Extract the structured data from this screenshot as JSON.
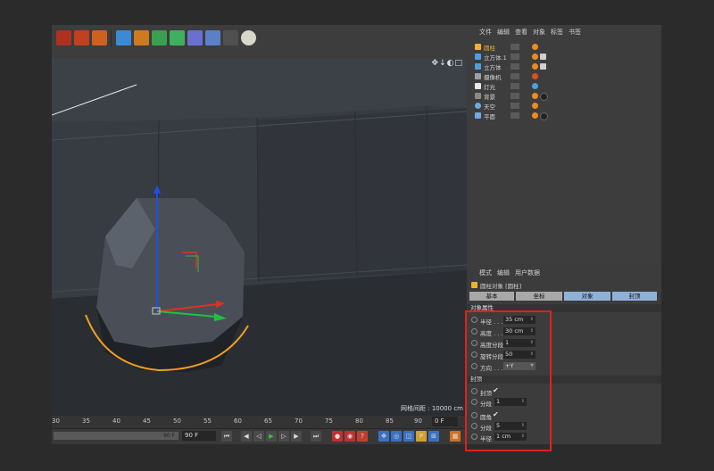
{
  "viewport": {
    "grid_spacing": "网格间距 : 10000 cm",
    "nav_icons": "✥↓◐□"
  },
  "timeline": {
    "ticks": [
      "30",
      "35",
      "40",
      "45",
      "50",
      "55",
      "60",
      "65",
      "70",
      "75",
      "80",
      "85",
      "90"
    ],
    "current_frame": "0 F",
    "range_end": "90 F",
    "end_frame": "90 F"
  },
  "object_manager": {
    "menu": [
      "文件",
      "编辑",
      "查看",
      "对象",
      "标签",
      "书签"
    ],
    "objects": [
      {
        "name": "圆柱",
        "color": "#f0b030",
        "tags": [
          "#f08a20"
        ]
      },
      {
        "name": "立方体.1",
        "color": "#4aa0e0",
        "tags": [
          "#f08a20",
          "#d0d0d0"
        ]
      },
      {
        "name": "立方体",
        "color": "#4aa0e0",
        "tags": [
          "#f08a20",
          "#d0d0d0"
        ]
      },
      {
        "name": "摄像机",
        "color": "#9aa0a8",
        "tags": [
          "#e05020"
        ]
      },
      {
        "name": "灯光",
        "color": "#e8e8e8",
        "tags": [
          "#4aa0e0"
        ]
      },
      {
        "name": "背景",
        "color": "#8a8a8a",
        "tags": [
          "#f08a20",
          "#222222"
        ]
      },
      {
        "name": "天空",
        "color": "#70a8e0",
        "tags": [
          "#f08a20"
        ]
      },
      {
        "name": "平面",
        "color": "#70a8e0",
        "tags": [
          "#f08a20",
          "#222222"
        ]
      }
    ]
  },
  "attribute_manager": {
    "menu": [
      "模式",
      "编辑",
      "用户数据"
    ],
    "object_title": "圆柱对象 [圆柱]",
    "tabs": [
      "基本",
      "坐标",
      "对象",
      "封顶"
    ],
    "section_object": "对象属性",
    "props": [
      {
        "label": "半径 . . .",
        "value": "35 cm"
      },
      {
        "label": "高度 . . .",
        "value": "30 cm"
      },
      {
        "label": "高度分段",
        "value": "1"
      },
      {
        "label": "旋转分段",
        "value": "50"
      },
      {
        "label": "方向 . . .",
        "value": "+Y"
      }
    ],
    "section_caps": "封顶",
    "caps": {
      "cap_label": "封顶",
      "cap_check": "✔",
      "cap_seg_label": "分段",
      "cap_seg_value": "1",
      "fillet_label": "圆角",
      "fillet_check": "✔",
      "fillet_seg_label": "分段",
      "fillet_seg_value": "5",
      "fillet_radius_label": "半径",
      "fillet_radius_value": "1 cm"
    }
  }
}
